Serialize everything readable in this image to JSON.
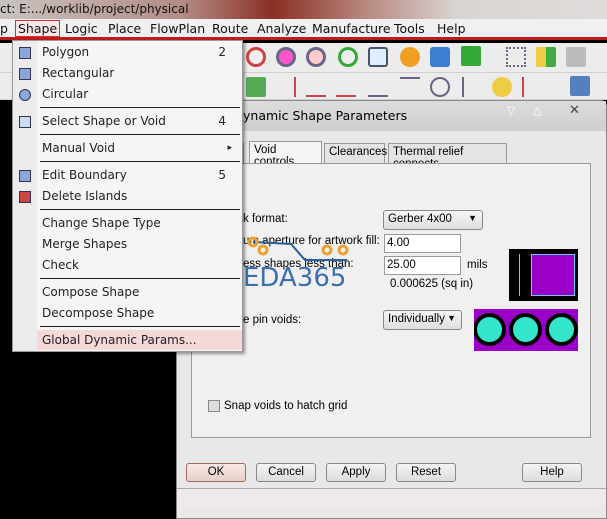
{
  "window": {
    "title": "ct: E:.../worklib/project/physical"
  },
  "menubar": [
    "p",
    "Shape",
    "Logic",
    "Place",
    "FlowPlan",
    "Route",
    "Analyze",
    "Manufacture",
    "Tools",
    "Help"
  ],
  "shape_menu": [
    {
      "label": "Polygon",
      "key": "2",
      "icon": "polygon-icon"
    },
    {
      "label": "Rectangular",
      "key": "",
      "icon": "rectangle-icon"
    },
    {
      "label": "Circular",
      "key": "",
      "icon": "circle-icon"
    },
    {
      "label": "Select Shape or Void",
      "key": "4",
      "icon": "select-arrow-icon"
    },
    {
      "label": "Manual Void",
      "key": "▸",
      "icon": ""
    },
    {
      "label": "Edit Boundary",
      "key": "5",
      "icon": "edit-boundary-icon"
    },
    {
      "label": "Delete Islands",
      "key": "",
      "icon": "delete-islands-icon"
    },
    {
      "label": "Change Shape Type",
      "key": ""
    },
    {
      "label": "Merge Shapes",
      "key": ""
    },
    {
      "label": "Check",
      "key": ""
    },
    {
      "label": "Compose Shape",
      "key": ""
    },
    {
      "label": "Decompose Shape",
      "key": ""
    },
    {
      "label": "Global Dynamic Params...",
      "key": "",
      "highlighted": true
    }
  ],
  "dialog": {
    "title": "ynamic Shape Parameters",
    "tabs": [
      "Void controls",
      "Clearances",
      "Thermal relief connects"
    ],
    "active_tab": "Void controls",
    "artwork_format_label": "k format:",
    "artwork_format_value": "Gerber 4x00",
    "min_aperture_label": "um aperture for artwork fill:",
    "min_aperture_value": "4.00",
    "suppress_label": "ess shapes less than:",
    "suppress_value": "25.00",
    "suppress_unit": "mils",
    "area_readout": "0.000625 (sq in)",
    "pin_voids_label": "e pin voids:",
    "pin_voids_value": "Individually",
    "snap_label": "Snap voids to hatch grid",
    "snap_checked": false,
    "buttons": [
      "OK",
      "Cancel",
      "Apply",
      "Reset",
      "Help"
    ]
  },
  "watermark": "EDA365",
  "colors": {
    "accent_red": "#c21a1a",
    "preview_magenta": "#9b00c8",
    "pin_cyan": "#33e6cc"
  }
}
